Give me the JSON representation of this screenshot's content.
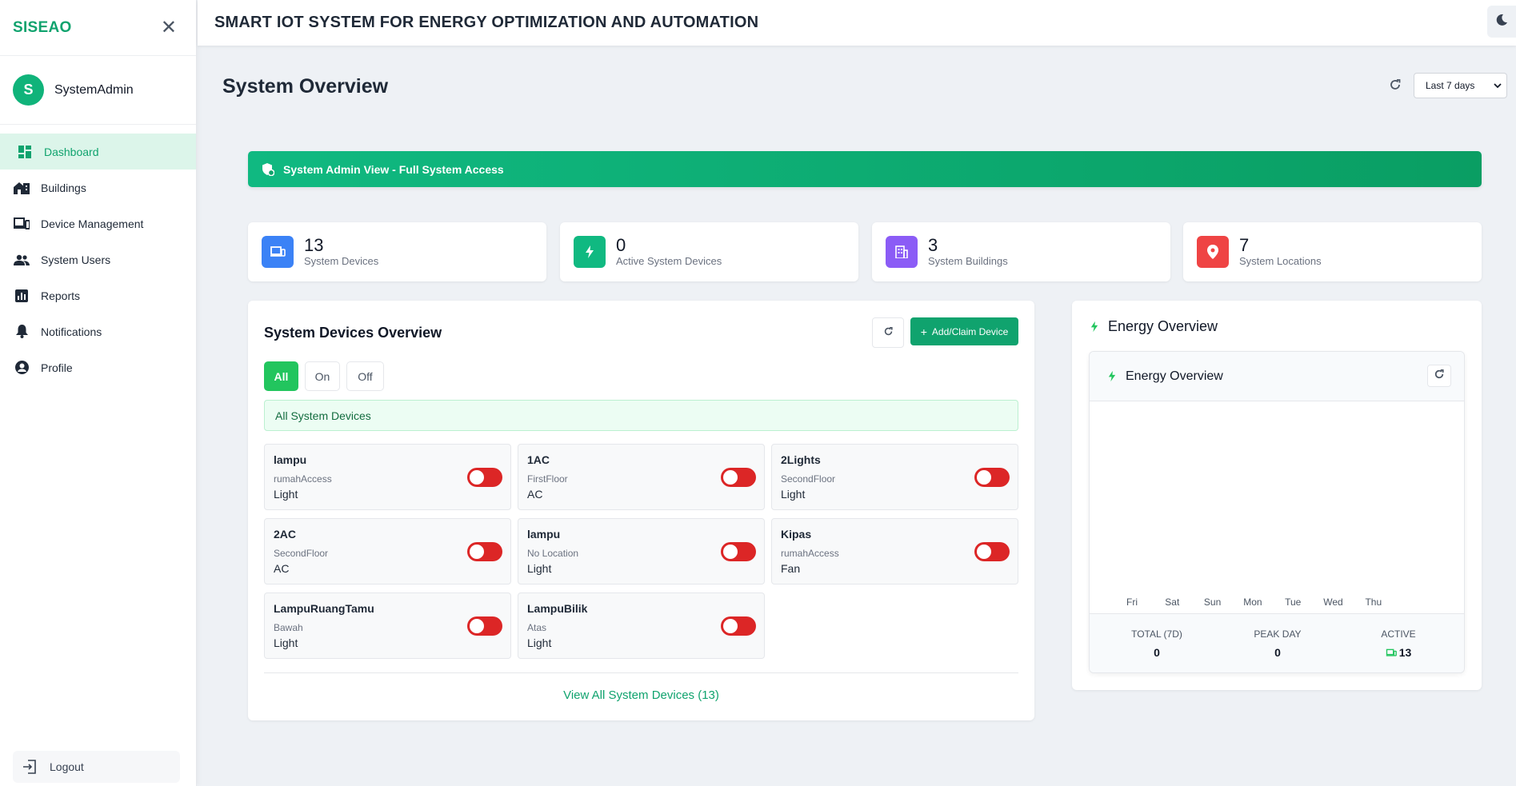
{
  "sidebar": {
    "brand": "SISEAO",
    "user": {
      "initial": "S",
      "name": "SystemAdmin"
    },
    "items": [
      {
        "label": "Dashboard",
        "icon": "dashboard-icon",
        "active": true
      },
      {
        "label": "Buildings",
        "icon": "buildings-icon"
      },
      {
        "label": "Device Management",
        "icon": "devices-icon"
      },
      {
        "label": "System Users",
        "icon": "users-icon"
      },
      {
        "label": "Reports",
        "icon": "reports-icon"
      },
      {
        "label": "Notifications",
        "icon": "bell-icon"
      },
      {
        "label": "Profile",
        "icon": "profile-icon"
      }
    ],
    "logout": "Logout"
  },
  "header": {
    "title": "SMART IOT SYSTEM FOR ENERGY OPTIMIZATION AND AUTOMATION"
  },
  "page": {
    "title": "System Overview",
    "range": "Last 7 days",
    "banner": "System Admin View - Full System Access"
  },
  "stats": [
    {
      "value": "13",
      "label": "System Devices",
      "color": "#3b82f6",
      "icon": "devices-icon"
    },
    {
      "value": "0",
      "label": "Active System Devices",
      "color": "#10b981",
      "icon": "bolt-icon"
    },
    {
      "value": "3",
      "label": "System Buildings",
      "color": "#8b5cf6",
      "icon": "building-icon"
    },
    {
      "value": "7",
      "label": "System Locations",
      "color": "#ef4444",
      "icon": "location-pin-icon"
    }
  ],
  "devices": {
    "title": "System Devices Overview",
    "add_label": "Add/Claim Device",
    "filters": [
      "All",
      "On",
      "Off"
    ],
    "active_filter": "All",
    "section_label": "All System Devices",
    "items": [
      {
        "name": "lampu",
        "location": "rumahAccess",
        "type": "Light",
        "on": false
      },
      {
        "name": "1AC",
        "location": "FirstFloor",
        "type": "AC",
        "on": false
      },
      {
        "name": "2Lights",
        "location": "SecondFloor",
        "type": "Light",
        "on": false
      },
      {
        "name": "2AC",
        "location": "SecondFloor",
        "type": "AC",
        "on": false
      },
      {
        "name": "lampu",
        "location": "No Location",
        "type": "Light",
        "on": false
      },
      {
        "name": "Kipas",
        "location": "rumahAccess",
        "type": "Fan",
        "on": false
      },
      {
        "name": "LampuRuangTamu",
        "location": "Bawah",
        "type": "Light",
        "on": false
      },
      {
        "name": "LampuBilik",
        "location": "Atas",
        "type": "Light",
        "on": false
      }
    ],
    "view_all": "View All System Devices (13)"
  },
  "energy": {
    "title": "Energy Overview",
    "inner_title": "Energy Overview",
    "days": [
      "Fri",
      "Sat",
      "Sun",
      "Mon",
      "Tue",
      "Wed",
      "Thu"
    ],
    "metrics": [
      {
        "label": "TOTAL (7D)",
        "value": "0"
      },
      {
        "label": "PEAK DAY",
        "value": "0"
      },
      {
        "label": "ACTIVE",
        "value": "13"
      }
    ]
  },
  "colors": {
    "accent": "#10a36e",
    "toggle_off": "#dc2626"
  }
}
